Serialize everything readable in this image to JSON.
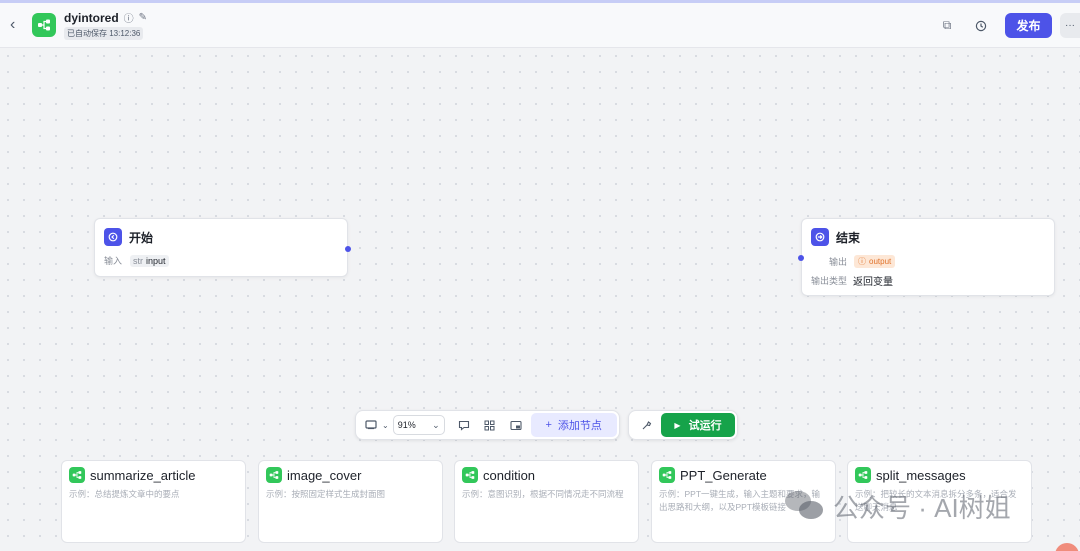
{
  "header": {
    "back_icon": "chevron-left-icon",
    "app_icon": "workflow-icon",
    "app_name": "dyintored",
    "save_status": "已自动保存 13:12:36",
    "publish_label": "发布",
    "more_label": "···"
  },
  "nodes": {
    "start": {
      "title": "开始",
      "input_label": "输入",
      "input_type": "str",
      "input_name": "input"
    },
    "end": {
      "title": "结束",
      "output_label": "输出",
      "output_name": "output",
      "output_type_label": "输出类型",
      "output_type_value": "返回变量"
    }
  },
  "toolbar": {
    "zoom": "91%",
    "add_node_label": "添加节点",
    "run_label": "试运行"
  },
  "cards": [
    {
      "title": "summarize_article",
      "desc": "示例：总结提炼文章中的要点"
    },
    {
      "title": "image_cover",
      "desc": "示例：按照固定样式生成封面图"
    },
    {
      "title": "condition",
      "desc": "示例：意图识别，根据不同情况走不同流程"
    },
    {
      "title": "PPT_Generate",
      "desc": "示例：PPT一键生成，输入主题和要求，输出思路和大纲，以及PPT模板链接"
    },
    {
      "title": "split_messages",
      "desc": "示例：把较长的文本消息拆分多条，适合发送聊天消息"
    }
  ],
  "watermark": "公众号 · AI树姐",
  "colors": {
    "accent": "#4d53e8",
    "run_green": "#16a34a",
    "template_green": "#32c75a",
    "output_orange": "#e0732c"
  }
}
